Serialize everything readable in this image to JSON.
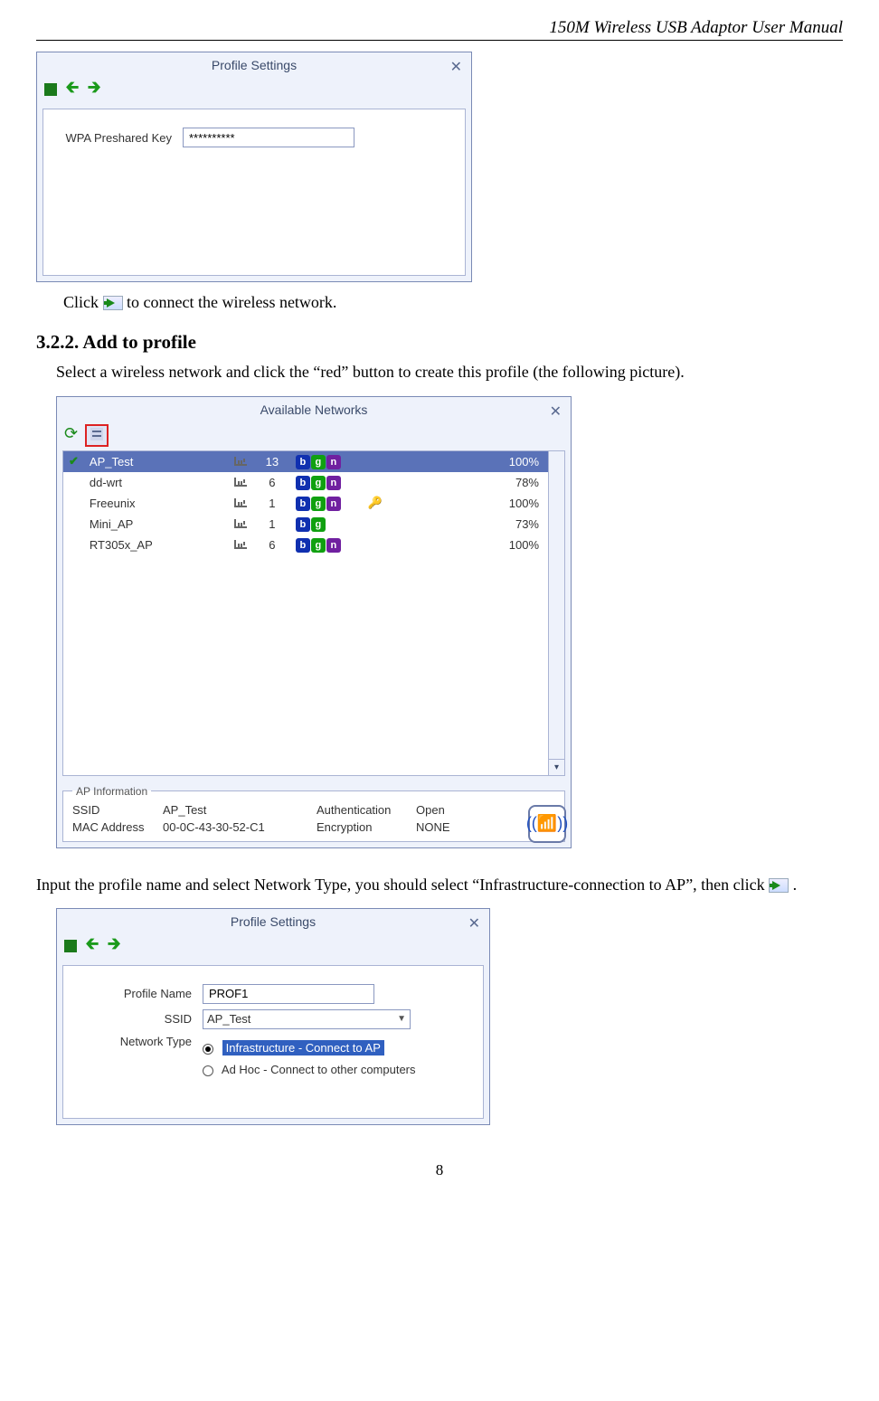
{
  "header": {
    "title": "150M Wireless USB Adaptor User Manual"
  },
  "dlg1": {
    "title": "Profile Settings",
    "field_label": "WPA Preshared Key",
    "field_value": "**********"
  },
  "text1_a": "Click ",
  "text1_b": " to connect the wireless network.",
  "section": {
    "num_title": "3.2.2. Add to profile"
  },
  "text2": "Select a wireless network and click the “red” button to create this profile (the following picture).",
  "dlg2": {
    "title": "Available Networks",
    "rows": [
      {
        "ssid": "AP_Test",
        "ch": "13",
        "b": true,
        "g": true,
        "n": true,
        "lock": false,
        "sig": "100%",
        "sel": true,
        "check": true
      },
      {
        "ssid": "dd-wrt",
        "ch": "6",
        "b": true,
        "g": true,
        "n": true,
        "lock": false,
        "sig": "78%",
        "sel": false,
        "check": false
      },
      {
        "ssid": "Freeunix",
        "ch": "1",
        "b": true,
        "g": true,
        "n": true,
        "lock": true,
        "sig": "100%",
        "sel": false,
        "check": false
      },
      {
        "ssid": "Mini_AP",
        "ch": "1",
        "b": true,
        "g": true,
        "n": false,
        "lock": false,
        "sig": "73%",
        "sel": false,
        "check": false
      },
      {
        "ssid": "RT305x_AP",
        "ch": "6",
        "b": true,
        "g": true,
        "n": true,
        "lock": false,
        "sig": "100%",
        "sel": false,
        "check": false
      }
    ],
    "ap_info": {
      "legend": "AP Information",
      "ssid_l": "SSID",
      "ssid_v": "AP_Test",
      "auth_l": "Authentication",
      "auth_v": "Open",
      "mac_l": "MAC Address",
      "mac_v": "00-0C-43-30-52-C1",
      "enc_l": "Encryption",
      "enc_v": "NONE"
    }
  },
  "text3_a": "Input the profile name and select Network Type, you should select “Infrastructure-connection to AP”, then click ",
  "text3_b": ".",
  "dlg3": {
    "title": "Profile Settings",
    "pn_l": "Profile Name",
    "pn_v": "PROF1",
    "ssid_l": "SSID",
    "ssid_v": "AP_Test",
    "nt_l": "Network Type",
    "opt1": "Infrastructure - Connect to AP",
    "opt2": "Ad Hoc - Connect to other computers"
  },
  "page_no": "8"
}
